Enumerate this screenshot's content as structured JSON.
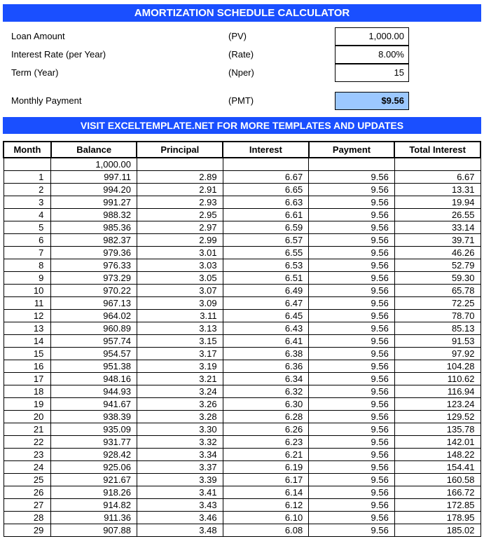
{
  "title": "AMORTIZATION SCHEDULE CALCULATOR",
  "inputs": {
    "loan_amount_label": "Loan Amount",
    "loan_amount_code": "(PV)",
    "loan_amount_value": "1,000.00",
    "rate_label": "Interest Rate (per Year)",
    "rate_code": "(Rate)",
    "rate_value": "8.00%",
    "term_label": "Term (Year)",
    "term_code": "(Nper)",
    "term_value": "15",
    "pmt_label": "Monthly Payment",
    "pmt_code": "(PMT)",
    "pmt_value": "$9.56"
  },
  "banner": "VISIT EXCELTEMPLATE.NET FOR MORE TEMPLATES AND UPDATES",
  "columns": [
    "Month",
    "Balance",
    "Principal",
    "Interest",
    "Payment",
    "Total Interest"
  ],
  "initial_balance": "1,000.00",
  "chart_data": {
    "type": "table",
    "columns": [
      "Month",
      "Balance",
      "Principal",
      "Interest",
      "Payment",
      "Total Interest"
    ],
    "rows": [
      [
        "1",
        "997.11",
        "2.89",
        "6.67",
        "9.56",
        "6.67"
      ],
      [
        "2",
        "994.20",
        "2.91",
        "6.65",
        "9.56",
        "13.31"
      ],
      [
        "3",
        "991.27",
        "2.93",
        "6.63",
        "9.56",
        "19.94"
      ],
      [
        "4",
        "988.32",
        "2.95",
        "6.61",
        "9.56",
        "26.55"
      ],
      [
        "5",
        "985.36",
        "2.97",
        "6.59",
        "9.56",
        "33.14"
      ],
      [
        "6",
        "982.37",
        "2.99",
        "6.57",
        "9.56",
        "39.71"
      ],
      [
        "7",
        "979.36",
        "3.01",
        "6.55",
        "9.56",
        "46.26"
      ],
      [
        "8",
        "976.33",
        "3.03",
        "6.53",
        "9.56",
        "52.79"
      ],
      [
        "9",
        "973.29",
        "3.05",
        "6.51",
        "9.56",
        "59.30"
      ],
      [
        "10",
        "970.22",
        "3.07",
        "6.49",
        "9.56",
        "65.78"
      ],
      [
        "11",
        "967.13",
        "3.09",
        "6.47",
        "9.56",
        "72.25"
      ],
      [
        "12",
        "964.02",
        "3.11",
        "6.45",
        "9.56",
        "78.70"
      ],
      [
        "13",
        "960.89",
        "3.13",
        "6.43",
        "9.56",
        "85.13"
      ],
      [
        "14",
        "957.74",
        "3.15",
        "6.41",
        "9.56",
        "91.53"
      ],
      [
        "15",
        "954.57",
        "3.17",
        "6.38",
        "9.56",
        "97.92"
      ],
      [
        "16",
        "951.38",
        "3.19",
        "6.36",
        "9.56",
        "104.28"
      ],
      [
        "17",
        "948.16",
        "3.21",
        "6.34",
        "9.56",
        "110.62"
      ],
      [
        "18",
        "944.93",
        "3.24",
        "6.32",
        "9.56",
        "116.94"
      ],
      [
        "19",
        "941.67",
        "3.26",
        "6.30",
        "9.56",
        "123.24"
      ],
      [
        "20",
        "938.39",
        "3.28",
        "6.28",
        "9.56",
        "129.52"
      ],
      [
        "21",
        "935.09",
        "3.30",
        "6.26",
        "9.56",
        "135.78"
      ],
      [
        "22",
        "931.77",
        "3.32",
        "6.23",
        "9.56",
        "142.01"
      ],
      [
        "23",
        "928.42",
        "3.34",
        "6.21",
        "9.56",
        "148.22"
      ],
      [
        "24",
        "925.06",
        "3.37",
        "6.19",
        "9.56",
        "154.41"
      ],
      [
        "25",
        "921.67",
        "3.39",
        "6.17",
        "9.56",
        "160.58"
      ],
      [
        "26",
        "918.26",
        "3.41",
        "6.14",
        "9.56",
        "166.72"
      ],
      [
        "27",
        "914.82",
        "3.43",
        "6.12",
        "9.56",
        "172.85"
      ],
      [
        "28",
        "911.36",
        "3.46",
        "6.10",
        "9.56",
        "178.95"
      ],
      [
        "29",
        "907.88",
        "3.48",
        "6.08",
        "9.56",
        "185.02"
      ]
    ]
  }
}
